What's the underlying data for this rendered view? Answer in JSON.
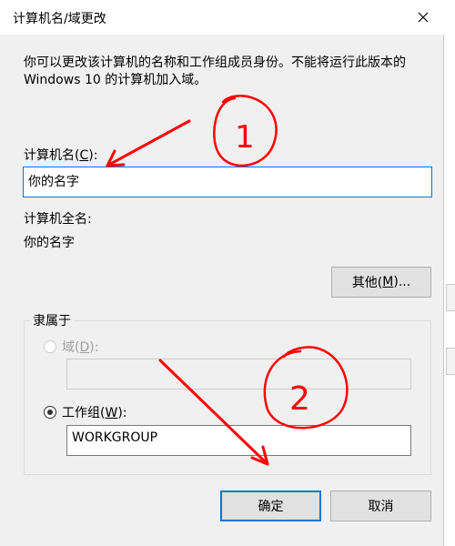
{
  "dialog": {
    "title": "计算机名/域更改",
    "description": "你可以更改该计算机的名称和工作组成员身份。不能将运行此版本的 Windows 10 的计算机加入域。"
  },
  "computer_name": {
    "label_prefix": "计算机名(",
    "label_key": "C",
    "label_suffix": "):",
    "value": "你的名字"
  },
  "full_name": {
    "label": "计算机全名:",
    "value": "你的名字"
  },
  "more_button": {
    "prefix": "其他(",
    "key": "M",
    "suffix": ")..."
  },
  "member_of": {
    "title": "隶属于",
    "domain": {
      "prefix": "域(",
      "key": "D",
      "suffix": "):",
      "value": ""
    },
    "workgroup": {
      "prefix": "工作组(",
      "key": "W",
      "suffix": "):",
      "value": "WORKGROUP"
    }
  },
  "buttons": {
    "ok": "确定",
    "cancel": "取消"
  },
  "annotations": {
    "mark_1": "1",
    "mark_2": "2",
    "color": "#ff0000"
  },
  "icons": {
    "close": "close-icon"
  }
}
